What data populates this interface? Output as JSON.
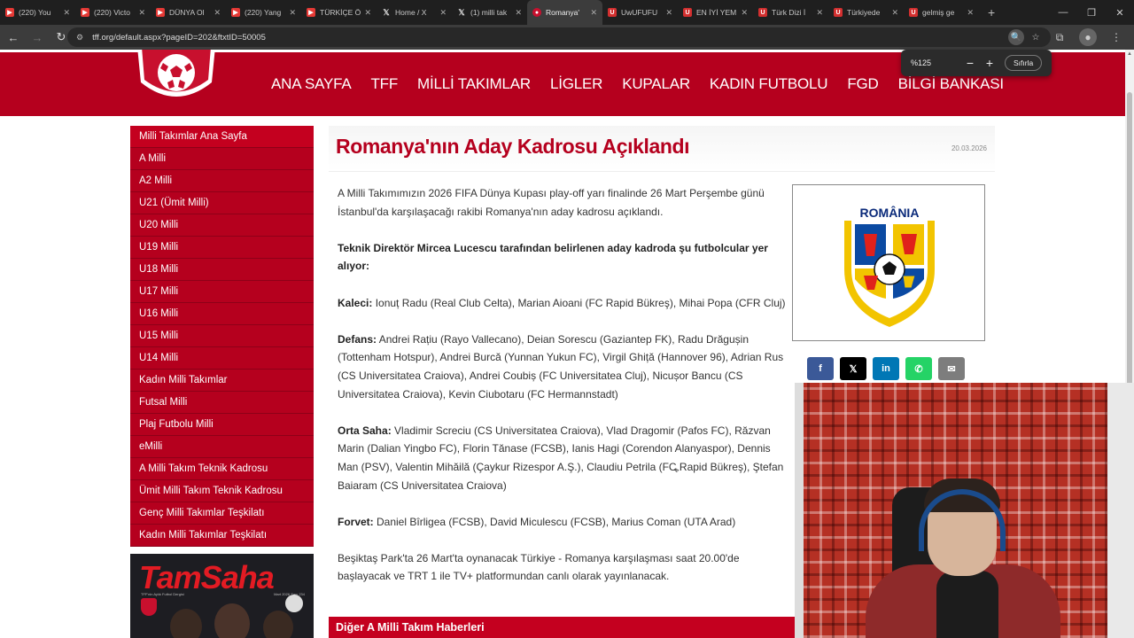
{
  "browser": {
    "tabs": [
      {
        "title": "(220) You",
        "favicon": "youtube-icon",
        "active": false
      },
      {
        "title": "(220) Victo",
        "favicon": "youtube-icon",
        "active": false
      },
      {
        "title": "DÜNYA Ol",
        "favicon": "youtube-icon",
        "active": false
      },
      {
        "title": "(220) Yang",
        "favicon": "youtube-icon",
        "active": false
      },
      {
        "title": "TÜRKİÇE Ö",
        "favicon": "youtube-icon",
        "active": false
      },
      {
        "title": "Home / X",
        "favicon": "x-icon",
        "active": false
      },
      {
        "title": "(1) milli tak",
        "favicon": "x-icon",
        "active": false
      },
      {
        "title": "Romanya'",
        "favicon": "tff-icon",
        "active": true
      },
      {
        "title": "UwUFUFU",
        "favicon": "u-icon",
        "active": false
      },
      {
        "title": "EN İYİ YEM",
        "favicon": "u-icon",
        "active": false
      },
      {
        "title": "Türk Dizi İ",
        "favicon": "u-icon",
        "active": false
      },
      {
        "title": "Türkiyede",
        "favicon": "u-icon",
        "active": false
      },
      {
        "title": "gelmiş ge",
        "favicon": "u-icon",
        "active": false
      }
    ],
    "url": "tff.org/default.aspx?pageID=202&ftxtID=50005",
    "zoom_popup": {
      "percent": "%125",
      "reset_label": "Sıfırla"
    }
  },
  "header": {
    "nav": [
      "ANA SAYFA",
      "TFF",
      "MİLLİ TAKIMLAR",
      "LİGLER",
      "KUPALAR",
      "KADIN FUTBOLU",
      "FGD",
      "BİLGİ BANKASI"
    ]
  },
  "sidebar": {
    "items": [
      "Milli Takımlar Ana Sayfa",
      "A Milli",
      "A2 Milli",
      "U21 (Ümit Milli)",
      "U20 Milli",
      "U19 Milli",
      "U18 Milli",
      "U17 Milli",
      "U16 Milli",
      "U15 Milli",
      "U14 Milli",
      "Kadın Milli Takımlar",
      "Futsal Milli",
      "Plaj Futbolu Milli",
      "eMilli",
      "A Milli Takım Teknik Kadrosu",
      "Ümit Milli Takım Teknik Kadrosu",
      "Genç Milli Takımlar Teşkilatı",
      "Kadın Milli Takımlar Teşkilatı"
    ],
    "promo": {
      "brand": "TamSaha",
      "left_caption": "TFF'nin Aylık Futbol Dergisi",
      "right_caption": "Mart 2026 Sayı 234"
    }
  },
  "article": {
    "title": "Romanya'nın Aday Kadrosu Açıklandı",
    "date": "20.03.2026",
    "intro": "A Milli Takımımızın 2026 FIFA Dünya Kupası play-off yarı finalinde 26 Mart Perşembe günü İstanbul'da karşılaşacağı rakibi Romanya'nın aday kadrosu açıklandı.",
    "lead": "Teknik Direktör Mircea Lucescu tarafından belirlenen aday kadroda şu futbolcular yer alıyor:",
    "sections": [
      {
        "label": "Kaleci:",
        "text": " Ionuț Radu (Real Club Celta), Marian Aioani (FC Rapid Bükreş), Mihai Popa (CFR Cluj)"
      },
      {
        "label": "Defans:",
        "text": " Andrei Rațiu (Rayo Vallecano), Deian Sorescu (Gaziantep FK), Radu Drăgușin (Tottenham Hotspur), Andrei Burcă (Yunnan Yukun FC), Virgil Ghiță (Hannover 96), Adrian Rus (CS Universitatea Craiova), Andrei Coubiș (FC Universitatea Cluj), Nicușor Bancu (CS Universitatea Craiova), Kevin Ciubotaru (FC Hermannstadt)"
      },
      {
        "label": "Orta Saha:",
        "text": " Vladimir Screciu (CS Universitatea Craiova), Vlad Dragomir (Pafos FC), Răzvan Marin (Dalian Yingbo FC), Florin Tănase (FCSB), Ianis Hagi (Corendon Alanyaspor), Dennis Man (PSV), Valentin Mihăilă (Çaykur Rizespor A.Ş.), Claudiu Petrila (FC Rapid Bükreş), Ştefan Baiaram (CS Universitatea Craiova)"
      },
      {
        "label": "Forvet:",
        "text": " Daniel Bîrligea (FCSB), David Miculescu (FCSB), Marius Coman (UTA Arad)"
      }
    ],
    "outro": "Beşiktaş Park'ta 26 Mart'ta oynanacak Türkiye - Romanya karşılaşması saat 20.00'de başlayacak ve TRT 1 ile TV+ platformundan canlı olarak yayınlanacak.",
    "flag_caption": "ROMÂNIA",
    "share": [
      "f",
      "𝕏",
      "in",
      "✆",
      "✉"
    ],
    "more_news": "Diğer A Milli Takım Haberleri"
  },
  "colors": {
    "brand_red": "#b5001e",
    "title_red": "#b5001e"
  }
}
